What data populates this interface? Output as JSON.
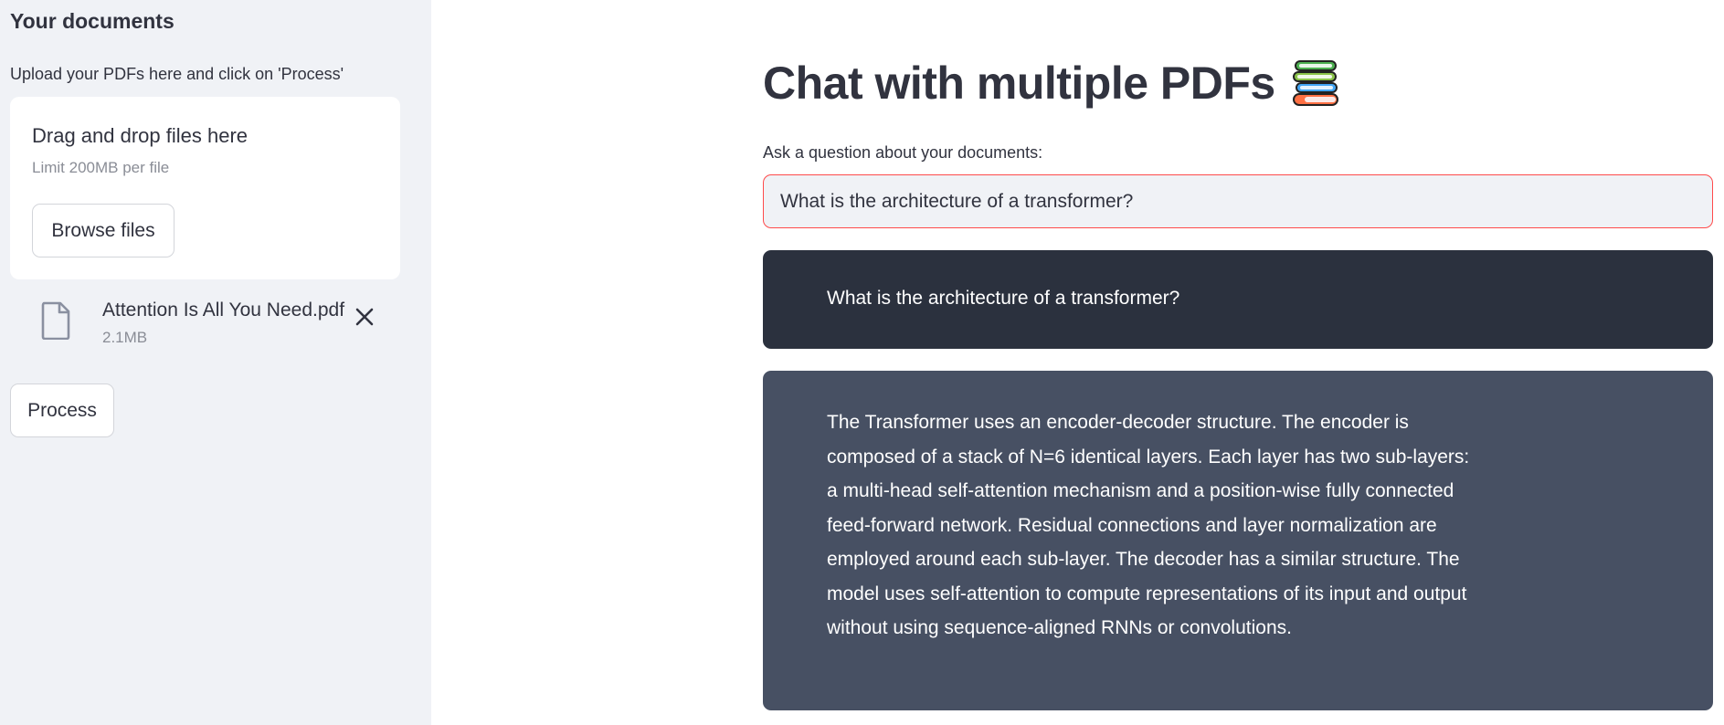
{
  "sidebar": {
    "title": "Your documents",
    "upload_hint": "Upload your PDFs here and click on 'Process'",
    "dropzone": {
      "title": "Drag and drop files here",
      "limit": "Limit 200MB per file",
      "browse_label": "Browse files"
    },
    "file": {
      "icon": "file-icon",
      "name": "Attention Is All You Need.pdf",
      "size": "2.1MB",
      "remove_icon": "close-icon"
    },
    "process_label": "Process"
  },
  "main": {
    "title": "Chat with multiple PDFs",
    "title_icon": "books-icon",
    "question_label": "Ask a question about your documents:",
    "question_value": "What is the architecture of a transformer?",
    "messages": [
      {
        "role": "user",
        "text": "What is the architecture of a transformer?"
      },
      {
        "role": "bot",
        "text": "The Transformer uses an encoder-decoder structure. The encoder is composed of a stack of N=6 identical layers. Each layer has two sub-layers: a multi-head self-attention mechanism and a position-wise fully connected feed-forward network. Residual connections and layer normalization are employed around each sub-layer. The decoder has a similar structure. The model uses self-attention to compute representations of its input and output without using sequence-aligned RNNs or convolutions."
      }
    ]
  },
  "colors": {
    "sidebar_bg": "#f0f2f6",
    "user_msg_bg": "#2b313e",
    "bot_msg_bg": "#475063",
    "input_focus_border": "#ff4b4b"
  }
}
